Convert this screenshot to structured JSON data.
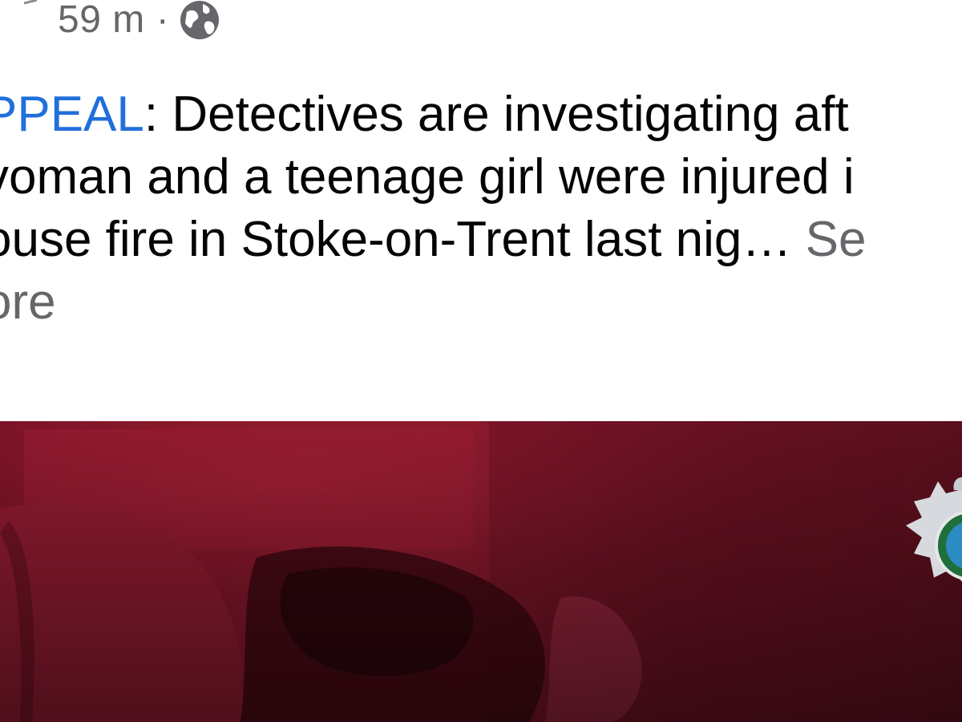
{
  "post": {
    "time": "59 m",
    "separator": "·",
    "audience_icon": "globe-icon",
    "text_lines": {
      "line1_tag": "PPEAL",
      "line1_rest": ": Detectives are investigating aft",
      "line2": "voman and a teenage girl were injured i",
      "line3_text": "ouse fire in Stoke-on-Trent last nig…",
      "line3_see": " Se",
      "line4_see": "ore"
    }
  },
  "image": {
    "description_icon": "police-crest-icon"
  },
  "colors": {
    "tag_blue": "#216fdb",
    "meta_gray": "#65676b",
    "text_black": "#050505",
    "photo_red": "#8a1a2e"
  }
}
